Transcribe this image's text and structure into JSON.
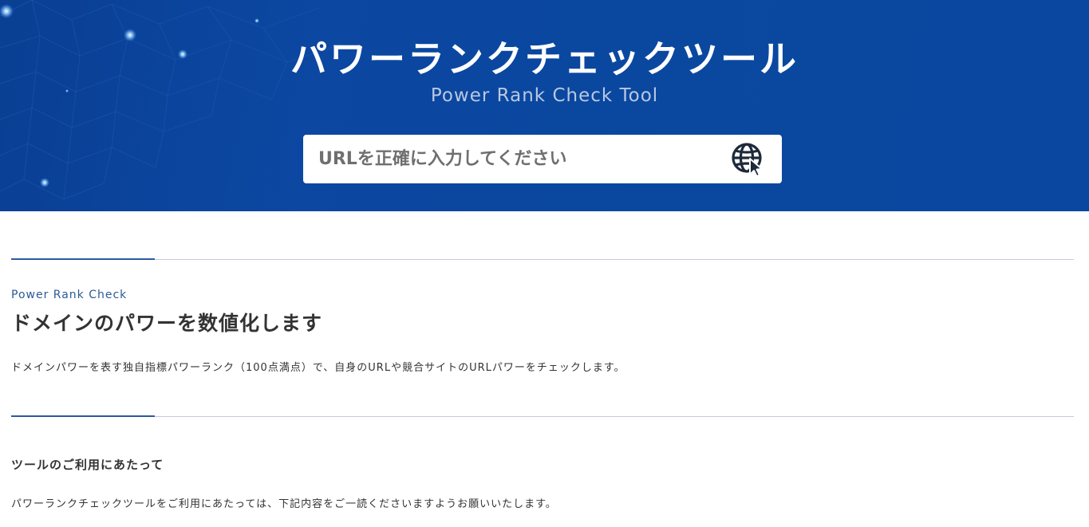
{
  "hero": {
    "title": "パワーランクチェックツール",
    "subtitle": "Power Rank Check Tool",
    "background_color": "#0a47a0"
  },
  "search": {
    "placeholder": "URLを正確に入力してください",
    "value": "",
    "button_icon": "globe-cursor-icon",
    "icon_color": "#1c2a3a"
  },
  "intro": {
    "eyebrow": "Power Rank Check",
    "title": "ドメインのパワーを数値化します",
    "text": "ドメインパワーを表す独自指標パワーランク（100点満点）で、自身のURLや競合サイトのURLパワーをチェックします。"
  },
  "usage": {
    "title": "ツールのご利用にあたって",
    "text": "パワーランクチェックツールをご利用にあたっては、下記内容をご一読くださいますようお願いいたします。"
  },
  "colors": {
    "accent": "#2c5aa0",
    "divider": "#c5ccd6",
    "text": "#333333"
  }
}
